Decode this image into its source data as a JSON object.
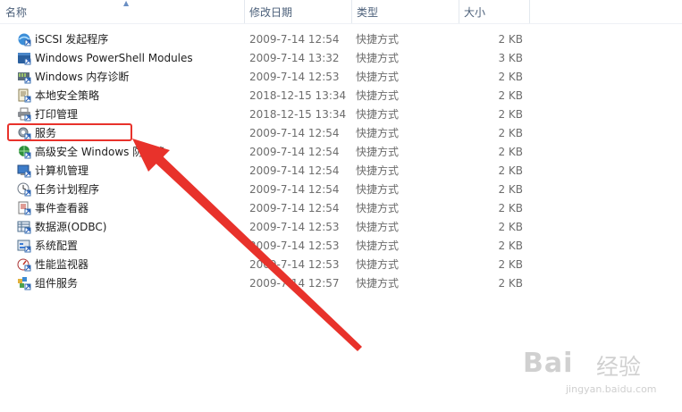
{
  "columns": {
    "name": "名称",
    "date": "修改日期",
    "type": "类型",
    "size": "大小"
  },
  "files": [
    {
      "name": "iSCSI 发起程序",
      "date": "2009-7-14 12:54",
      "type": "快捷方式",
      "size": "2 KB",
      "icon": "iscsi-icon"
    },
    {
      "name": "Windows PowerShell Modules",
      "date": "2009-7-14 13:32",
      "type": "快捷方式",
      "size": "3 KB",
      "icon": "powershell-icon"
    },
    {
      "name": "Windows 内存诊断",
      "date": "2009-7-14 12:53",
      "type": "快捷方式",
      "size": "2 KB",
      "icon": "memory-diagnostic-icon"
    },
    {
      "name": "本地安全策略",
      "date": "2018-12-15 13:34",
      "type": "快捷方式",
      "size": "2 KB",
      "icon": "security-policy-icon"
    },
    {
      "name": "打印管理",
      "date": "2018-12-15 13:34",
      "type": "快捷方式",
      "size": "2 KB",
      "icon": "printer-icon"
    },
    {
      "name": "服务",
      "date": "2009-7-14 12:54",
      "type": "快捷方式",
      "size": "2 KB",
      "icon": "services-icon"
    },
    {
      "name": "高级安全 Windows 防火墙",
      "date": "2009-7-14 12:54",
      "type": "快捷方式",
      "size": "2 KB",
      "icon": "firewall-icon"
    },
    {
      "name": "计算机管理",
      "date": "2009-7-14 12:54",
      "type": "快捷方式",
      "size": "2 KB",
      "icon": "computer-management-icon"
    },
    {
      "name": "任务计划程序",
      "date": "2009-7-14 12:54",
      "type": "快捷方式",
      "size": "2 KB",
      "icon": "task-scheduler-icon"
    },
    {
      "name": "事件查看器",
      "date": "2009-7-14 12:54",
      "type": "快捷方式",
      "size": "2 KB",
      "icon": "event-viewer-icon"
    },
    {
      "name": "数据源(ODBC)",
      "date": "2009-7-14 12:53",
      "type": "快捷方式",
      "size": "2 KB",
      "icon": "odbc-icon"
    },
    {
      "name": "系统配置",
      "date": "2009-7-14 12:53",
      "type": "快捷方式",
      "size": "2 KB",
      "icon": "system-config-icon"
    },
    {
      "name": "性能监视器",
      "date": "2009-7-14 12:53",
      "type": "快捷方式",
      "size": "2 KB",
      "icon": "performance-monitor-icon"
    },
    {
      "name": "组件服务",
      "date": "2009-7-14 12:57",
      "type": "快捷方式",
      "size": "2 KB",
      "icon": "component-services-icon"
    }
  ],
  "annotation": {
    "highlight_color": "#e8322b"
  },
  "watermark": {
    "logo": "Bai",
    "sub": "经验",
    "url": "jingyan.baidu.com"
  }
}
